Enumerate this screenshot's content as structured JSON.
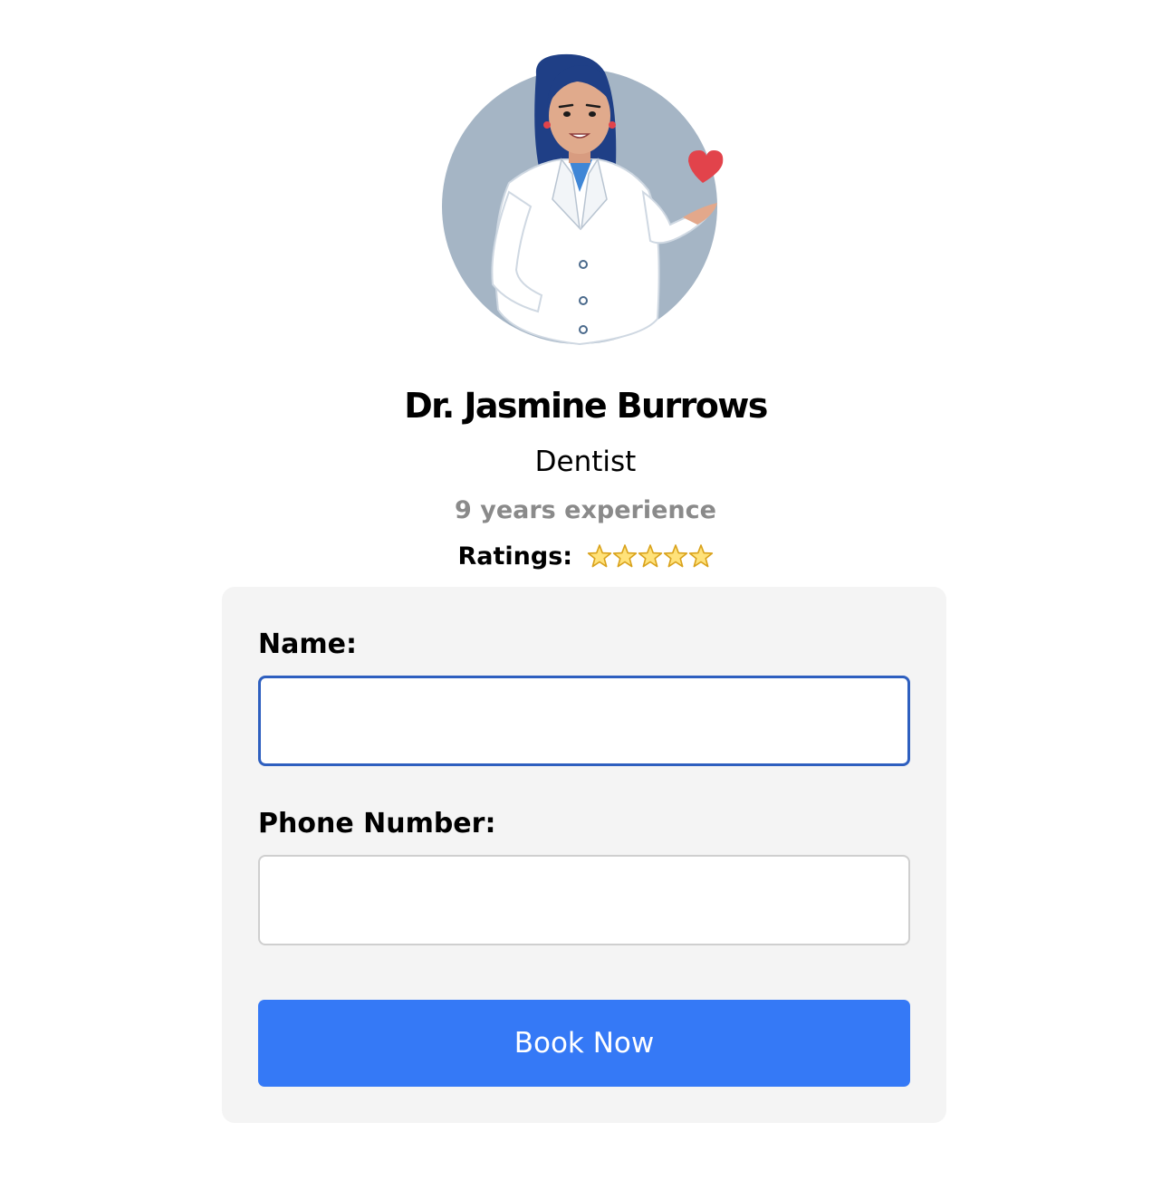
{
  "doctor": {
    "name": "Dr. Jasmine Burrows",
    "specialty": "Dentist",
    "experience": "9 years experience",
    "ratings_label": "Ratings:",
    "rating_stars": 5,
    "rating_max": 5,
    "avatar_icon": "doctor-avatar-illustration"
  },
  "form": {
    "name_label": "Name:",
    "name_value": "",
    "phone_label": "Phone Number:",
    "phone_value": "",
    "submit_label": "Book Now"
  },
  "colors": {
    "accent": "#3579f6",
    "focus_border": "#2e5fbf",
    "card_background": "#f4f4f4",
    "muted_text": "#8a8a8a",
    "avatar_circle": "#a5b5c5",
    "heart": "#e2434b",
    "star_fill": "#ffe27a"
  }
}
